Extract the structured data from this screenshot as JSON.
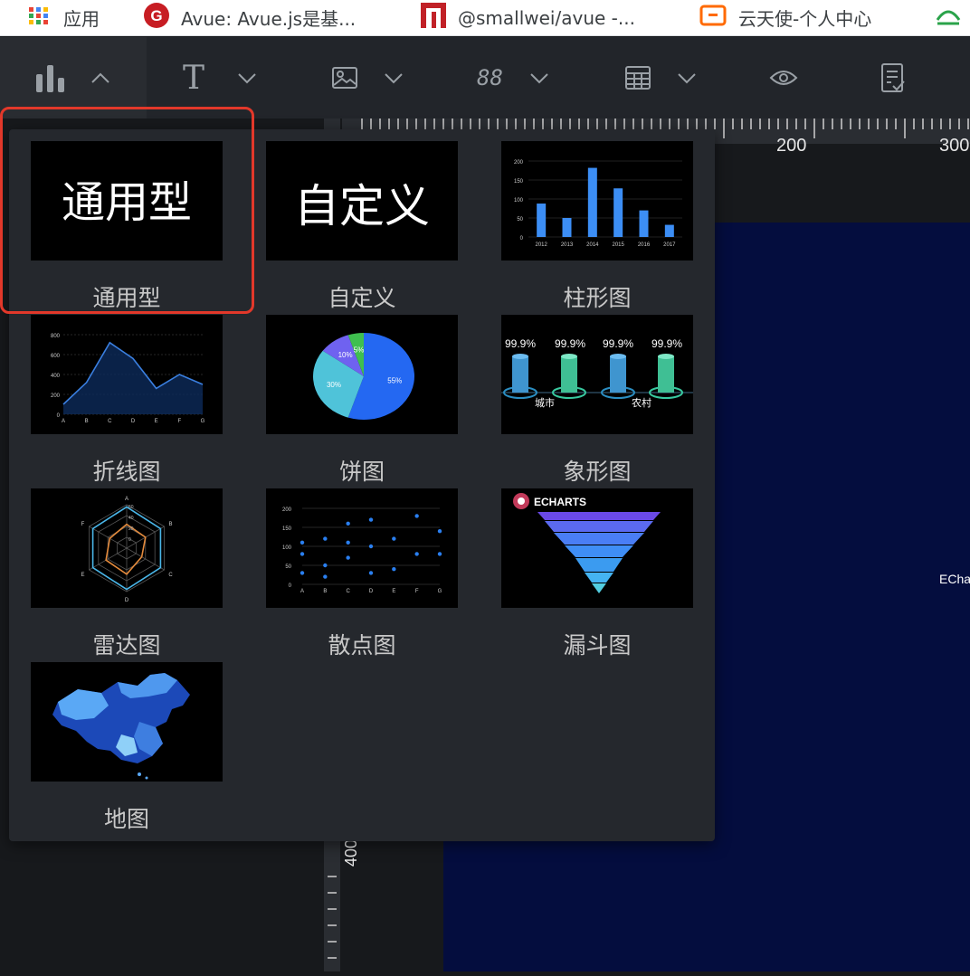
{
  "bookmarks": [
    {
      "label": "应用",
      "icon": "apps-grid-icon"
    },
    {
      "label": "Avue: Avue.js是基...",
      "icon": "gitee-icon"
    },
    {
      "label": "@smallwei/avue -...",
      "icon": "npm-icon"
    },
    {
      "label": "云天使-个人中心",
      "icon": "cloud-icon"
    }
  ],
  "toolbar": {
    "items": [
      {
        "name": "chart-tool",
        "icon": "bar-chart-icon",
        "arrow": "chevron-up-icon",
        "active": true
      },
      {
        "name": "text-tool",
        "icon": "text-icon",
        "arrow": "chevron-down-icon"
      },
      {
        "name": "image-tool",
        "icon": "image-icon",
        "arrow": "chevron-down-icon"
      },
      {
        "name": "digital-tool",
        "icon": "digital-88-icon",
        "arrow": "chevron-down-icon"
      },
      {
        "name": "table-tool",
        "icon": "table-icon",
        "arrow": "chevron-down-icon"
      },
      {
        "name": "preview-tool",
        "icon": "eye-icon"
      },
      {
        "name": "save-tool",
        "icon": "document-check-icon"
      }
    ],
    "digital_glyph": "88",
    "text_glyph": "T"
  },
  "rulers": {
    "h_labels": [
      "200",
      "300"
    ],
    "v_label": "400"
  },
  "stage": {
    "partial_text": "ECha"
  },
  "chart_types": [
    {
      "label": "通用型",
      "thumb_text": "通用型",
      "selected": true
    },
    {
      "label": "自定义",
      "thumb_text": "自定义"
    },
    {
      "label": "柱形图"
    },
    {
      "label": "折线图"
    },
    {
      "label": "饼图"
    },
    {
      "label": "象形图"
    },
    {
      "label": "雷达图"
    },
    {
      "label": "散点图"
    },
    {
      "label": "漏斗图"
    },
    {
      "label": "地图"
    }
  ],
  "thumbs": {
    "bar": {
      "years": [
        "2012",
        "2013",
        "2014",
        "2015",
        "2016",
        "2017"
      ],
      "values": [
        88,
        50,
        182,
        128,
        70,
        32
      ],
      "yticks": [
        "200",
        "150",
        "100",
        "50",
        "0"
      ],
      "ymax": 200
    },
    "line": {
      "cats": [
        "A",
        "B",
        "C",
        "D",
        "E",
        "F",
        "G"
      ],
      "values": [
        100,
        320,
        720,
        560,
        260,
        400,
        300
      ],
      "yticks": [
        "800",
        "600",
        "400",
        "200",
        "0"
      ],
      "ymax": 800
    },
    "pie": {
      "slices": [
        {
          "label": "55%",
          "value": 55,
          "color": "#2468f2"
        },
        {
          "label": "30%",
          "value": 30,
          "color": "#4fc3d9"
        },
        {
          "label": "10%",
          "value": 10,
          "color": "#6f62f0"
        },
        {
          "label": "5%",
          "value": 5,
          "color": "#3fbf4f"
        }
      ]
    },
    "pictorial": {
      "values": [
        "99.9%",
        "99.9%",
        "99.9%",
        "99.9%"
      ],
      "labels": [
        "城市",
        "农村"
      ]
    },
    "radar": {
      "axes": [
        "A",
        "B",
        "C",
        "D",
        "E",
        "F"
      ],
      "rings": [
        "60",
        "40",
        "20",
        "0"
      ]
    },
    "scatter": {
      "cats": [
        "A",
        "B",
        "C",
        "D",
        "E",
        "F",
        "G"
      ],
      "yticks": [
        "200",
        "150",
        "100",
        "50",
        "0"
      ]
    },
    "funnel": {
      "brand": "ECHARTS"
    }
  }
}
